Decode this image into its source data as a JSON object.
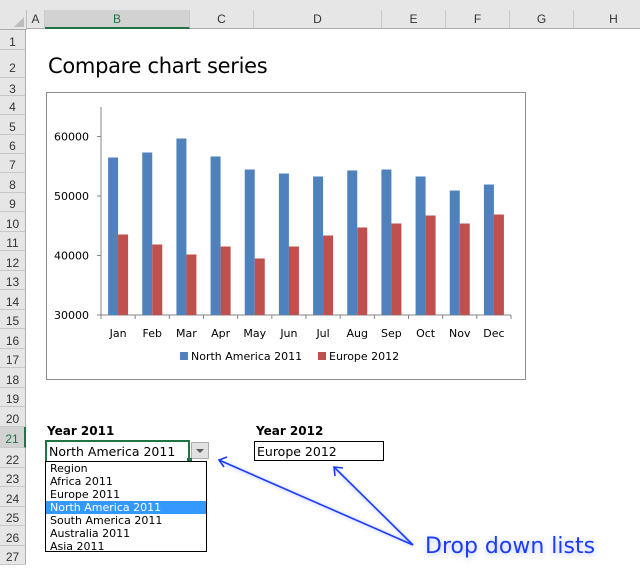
{
  "spreadsheet": {
    "columns": [
      "A",
      "B",
      "C",
      "D",
      "E",
      "F",
      "G",
      "H"
    ],
    "selected_column": "B",
    "rows": [
      "1",
      "2",
      "3",
      "4",
      "5",
      "6",
      "7",
      "8",
      "9",
      "10",
      "11",
      "12",
      "13",
      "14",
      "15",
      "16",
      "17",
      "18",
      "19",
      "20",
      "21",
      "22",
      "23",
      "24",
      "25",
      "26",
      "27"
    ],
    "selected_row": "21"
  },
  "sheet_title": "Compare chart series",
  "chart_data": {
    "type": "bar",
    "title": "",
    "xlabel": "",
    "ylabel": "",
    "categories": [
      "Jan",
      "Feb",
      "Mar",
      "Apr",
      "May",
      "Jun",
      "Jul",
      "Aug",
      "Sep",
      "Oct",
      "Nov",
      "Dec"
    ],
    "series": [
      {
        "name": "North America 2011",
        "color": "#4f81bd",
        "values": [
          56470,
          57310,
          59660,
          56640,
          54450,
          53780,
          53280,
          54290,
          54450,
          53280,
          50920,
          51930
        ]
      },
      {
        "name": "Europe 2012",
        "color": "#c0504d",
        "values": [
          43530,
          41850,
          40170,
          41510,
          39500,
          41510,
          43360,
          44710,
          45380,
          46720,
          45380,
          46890
        ]
      }
    ],
    "ylim": [
      30000,
      65000
    ],
    "yticks": [
      "30000",
      "40000",
      "50000",
      "60000"
    ],
    "ytick_values": [
      30000,
      40000,
      50000,
      60000
    ],
    "grid": false,
    "legend_position": "bottom"
  },
  "controls": {
    "year2011_label": "Year 2011",
    "year2011_value": "North America 2011",
    "year2011_options": [
      "Region",
      "Africa 2011",
      "Europe 2011",
      "North America 2011",
      "South America 2011",
      "Australia 2011",
      "Asia 2011"
    ],
    "year2011_highlighted": "North America 2011",
    "year2012_label": "Year 2012",
    "year2012_value": "Europe 2012"
  },
  "annotation": {
    "text": "Drop down lists",
    "color": "#1a3cff"
  }
}
